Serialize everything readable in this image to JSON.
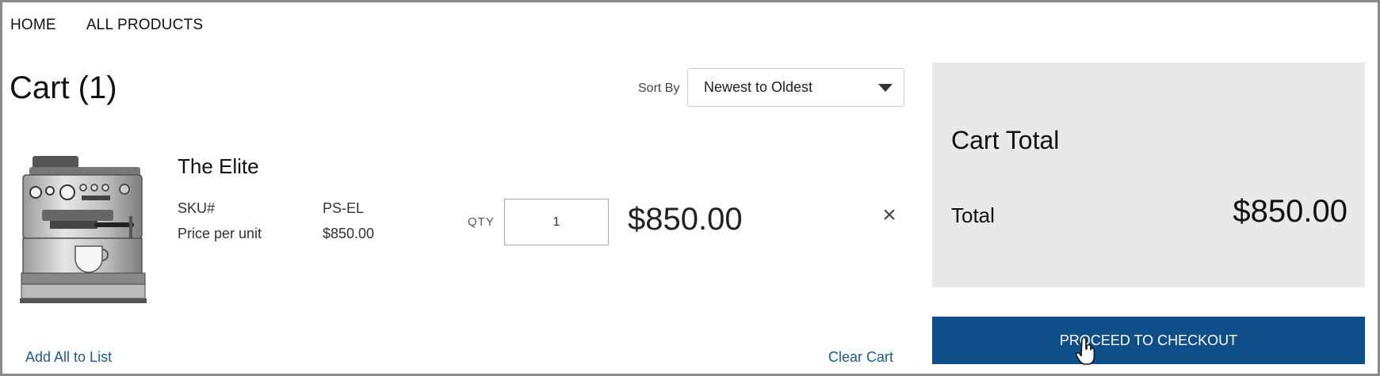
{
  "nav": {
    "items": [
      {
        "label": "HOME"
      },
      {
        "label": "ALL PRODUCTS"
      }
    ]
  },
  "cart": {
    "title": "Cart (1)",
    "sort_label": "Sort By",
    "sort_value": "Newest to Oldest",
    "items": [
      {
        "name": "The Elite",
        "sku_label": "SKU#",
        "sku_value": "PS-EL",
        "price_label": "Price per unit",
        "price_value": "$850.00",
        "qty_label": "QTY",
        "qty_value": "1",
        "line_total": "$850.00",
        "remove_symbol": "×",
        "image_icon": "espresso-machine-image"
      }
    ],
    "add_all_link": "Add All to List",
    "clear_link": "Clear Cart"
  },
  "summary": {
    "heading": "Cart Total",
    "total_label": "Total",
    "total_value": "$850.00",
    "checkout_label": "PROCEED TO CHECKOUT"
  },
  "colors": {
    "accent": "#0e4f8a",
    "link": "#1d5a8c",
    "panel_bg": "#e9e9e9"
  }
}
